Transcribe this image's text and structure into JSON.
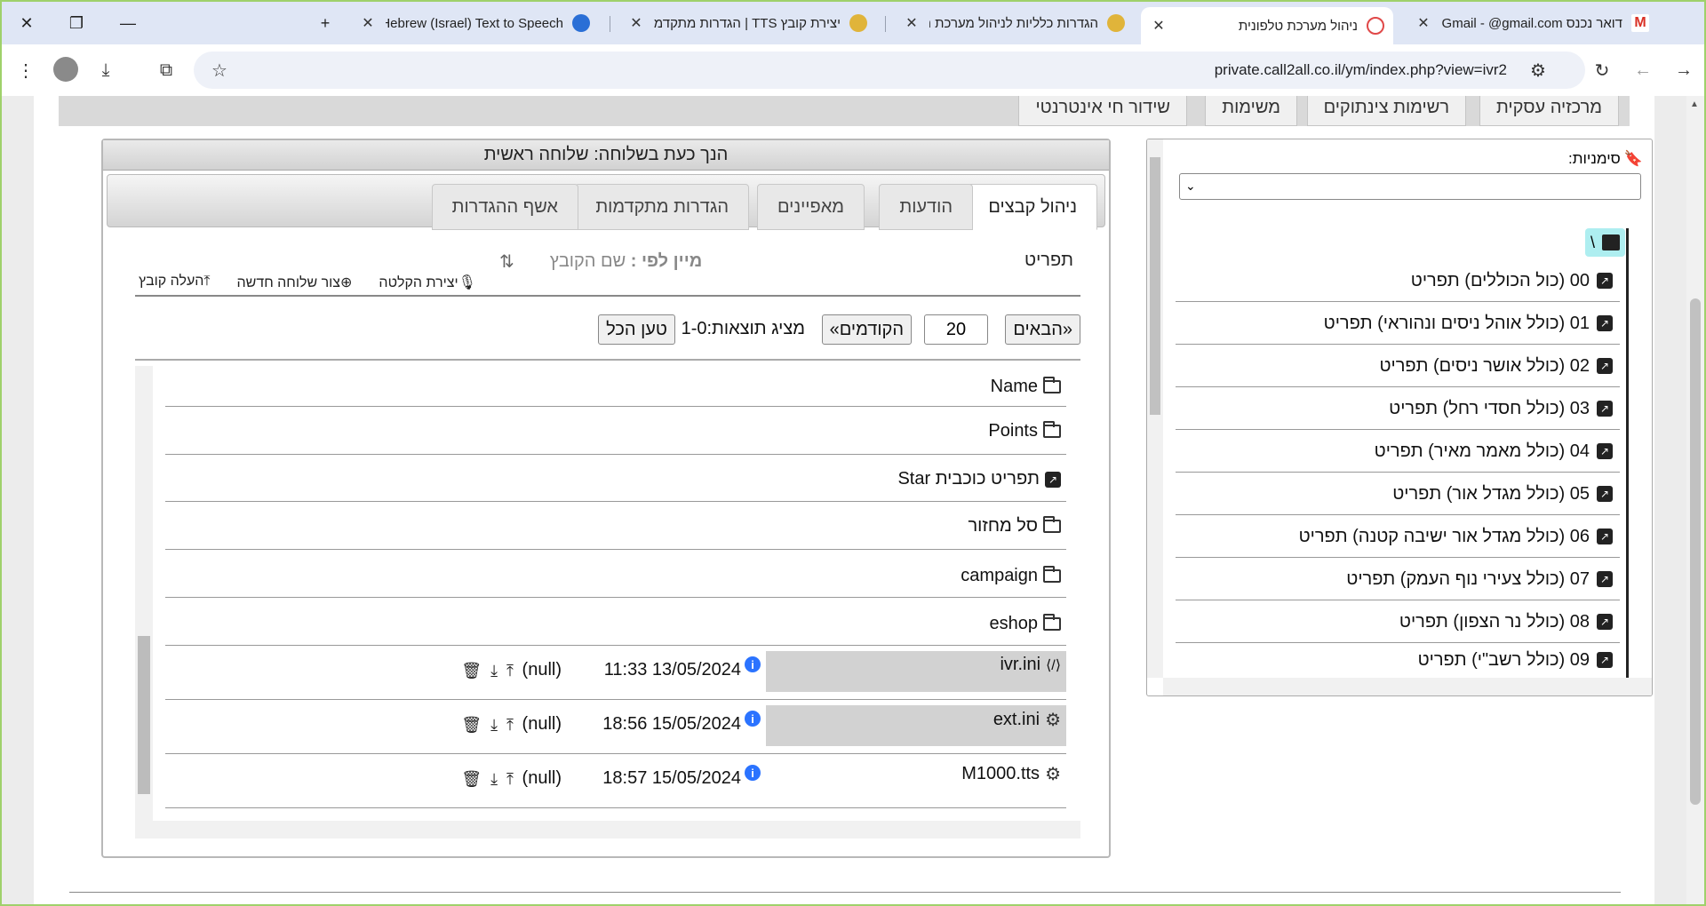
{
  "browser": {
    "tabs": [
      {
        "title": "דואר נכנס Gmail - @gmail.com",
        "active": false
      },
      {
        "title": "ניהול מערכת טלפונית",
        "active": true
      },
      {
        "title": "הגדרות כלליות לניהול מערכת ה",
        "active": false
      },
      {
        "title": "יצירת קובץ TTS | הגדרות מתקדמות",
        "active": false
      },
      {
        "title": "Hebrew (Israel) Text to Speech",
        "active": false
      }
    ],
    "new_tab": "+",
    "url": "private.call2all.co.il/ym/index.php?view=ivr2"
  },
  "topnav": {
    "items": [
      "מרכזיה עסקית",
      "רשימות צינתוקים",
      "משימות",
      "שידור חי אינטרנטי"
    ]
  },
  "bookmarks_panel": {
    "label": "סימניות:",
    "select_value": "",
    "root": "\\",
    "items": [
      "00 (כול הכוללים) תפריט",
      "01 (כולל אוהל ניסים ונהוראי) תפריט",
      "02 (כולל אושר ניסים) תפריט",
      "03 (כולל חסדי רחל) תפריט",
      "04 (כולל מאמר מאיר) תפריט",
      "05 (כולל מגדל אור) תפריט",
      "06 (כולל מגדל אור ישיבה קטנה) תפריט",
      "07 (כולל צעירי נוף העמק) תפריט",
      "08 (כולל נר הצפון) תפריט",
      "09 (כולל רשב\"י) תפריט"
    ]
  },
  "main_panel": {
    "header": "הנך כעת בשלוחה: שלוחה ראשית",
    "subtabs": [
      "ניהול קבצים",
      "הודעות",
      "מאפיינים",
      "הגדרות מתקדמות",
      "אשף ההגדרות"
    ],
    "content_title": "תפריט",
    "sort_label": "מיין לפי :",
    "sort_value": "שם הקובץ",
    "actions": {
      "record": "יצירת הקלטה",
      "new_extension": "צור שלוחה חדשה",
      "upload": "העלה קובץ"
    },
    "pager": {
      "next": "«הבאים",
      "page_size": "20",
      "prev": "הקודמים»",
      "results": "מציג תוצאות:1-0",
      "load_all": "טען הכל"
    },
    "files": [
      {
        "name": "Name",
        "kind": "folder"
      },
      {
        "name": "Points",
        "kind": "folder"
      },
      {
        "name": "Star תפריט כוכבית",
        "kind": "link"
      },
      {
        "name": "סל מחזור",
        "kind": "folder"
      },
      {
        "name": "campaign",
        "kind": "folder"
      },
      {
        "name": "eshop",
        "kind": "folder"
      },
      {
        "name": "ivr.ini",
        "kind": "file",
        "date": "11:33 13/05/2024",
        "size": "(null)"
      },
      {
        "name": "ext.ini",
        "kind": "file",
        "date": "18:56 15/05/2024",
        "size": "(null)"
      },
      {
        "name": "M1000.tts",
        "kind": "file",
        "date": "18:57 15/05/2024",
        "size": "(null)"
      }
    ]
  }
}
